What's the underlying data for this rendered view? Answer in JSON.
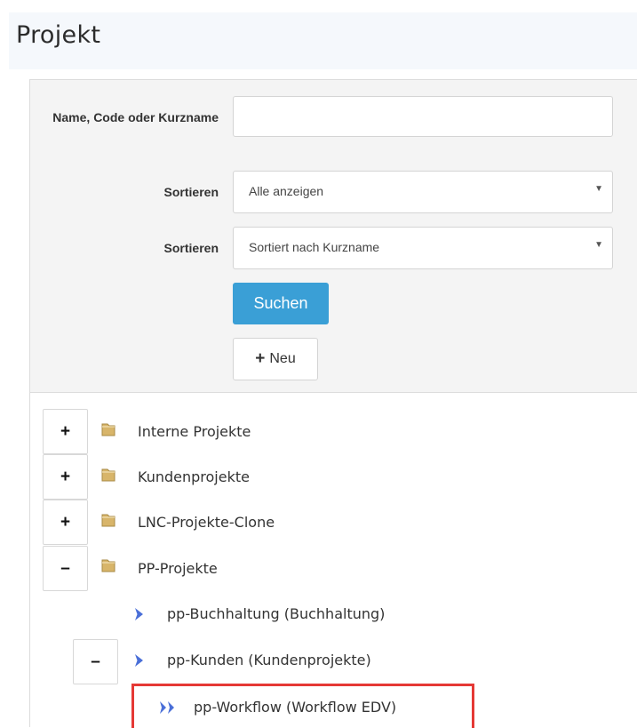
{
  "page": {
    "title": "Projekt"
  },
  "filter": {
    "name_label": "Name, Code oder Kurzname",
    "name_value": "",
    "sort1_label": "Sortieren",
    "sort1_value": "Alle anzeigen",
    "sort2_label": "Sortieren",
    "sort2_value": "Sortiert nach Kurzname",
    "search_label": "Suchen",
    "new_label": "Neu",
    "new_icon": "+"
  },
  "tree": {
    "items": [
      {
        "label": "Interne Projekte",
        "toggle": "+",
        "icon": "folder-icon"
      },
      {
        "label": "Kundenprojekte",
        "toggle": "+",
        "icon": "folder-icon"
      },
      {
        "label": "LNC-Projekte-Clone",
        "toggle": "+",
        "icon": "folder-icon"
      },
      {
        "label": "PP-Projekte",
        "toggle": "–",
        "icon": "folder-icon"
      },
      {
        "label": "pp-Buchhaltung (Buchhaltung)",
        "icon": "chevron-right-icon"
      },
      {
        "label": "pp-Kunden (Kundenprojekte)",
        "toggle": "–",
        "icon": "chevron-right-icon"
      },
      {
        "label": "pp-Workflow (Workflow EDV)",
        "icon": "double-chevron-right-icon",
        "highlighted": true
      }
    ]
  },
  "colors": {
    "primary_button": "#3a9fd6",
    "arrow": "#4a6fd8",
    "highlight_border": "#e53935",
    "folder": "#d8b56a"
  }
}
